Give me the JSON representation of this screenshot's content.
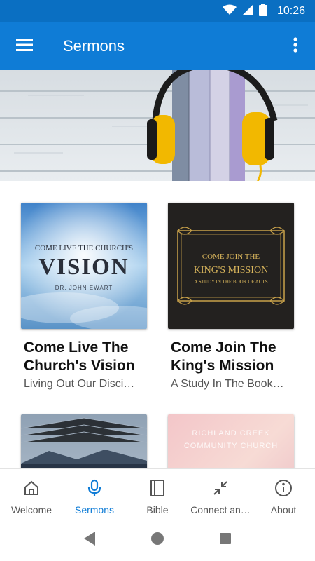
{
  "status_bar": {
    "time": "10:26"
  },
  "app_bar": {
    "title": "Sermons"
  },
  "sermons": [
    {
      "title": "Come Live The Church's Vision",
      "subtitle": "Living Out Our Disci…",
      "art_line1": "COME LIVE THE CHURCH'S",
      "art_line2": "VISION",
      "art_line3": "DR. JOHN EWART"
    },
    {
      "title": "Come Join The King's Mission",
      "subtitle": "A Study In The Book…",
      "art_line1": "COME JOIN THE",
      "art_line2": "KING'S MISSION",
      "art_line3": "A STUDY IN THE BOOK OF ACTS"
    },
    {
      "title": "",
      "subtitle": ""
    },
    {
      "title": "",
      "subtitle": "",
      "art_line1": "RICHLAND CREEK",
      "art_line2": "COMMUNITY CHURCH"
    }
  ],
  "bottom_nav": [
    {
      "label": "Welcome",
      "icon": "home-icon",
      "active": false
    },
    {
      "label": "Sermons",
      "icon": "microphone-icon",
      "active": true
    },
    {
      "label": "Bible",
      "icon": "book-icon",
      "active": false
    },
    {
      "label": "Connect an…",
      "icon": "collapse-arrows-icon",
      "active": false
    },
    {
      "label": "About",
      "icon": "info-icon",
      "active": false
    }
  ],
  "colors": {
    "primary": "#0f7cd6",
    "status_bar": "#0a6fc2",
    "active_nav": "#0f7cd6"
  }
}
